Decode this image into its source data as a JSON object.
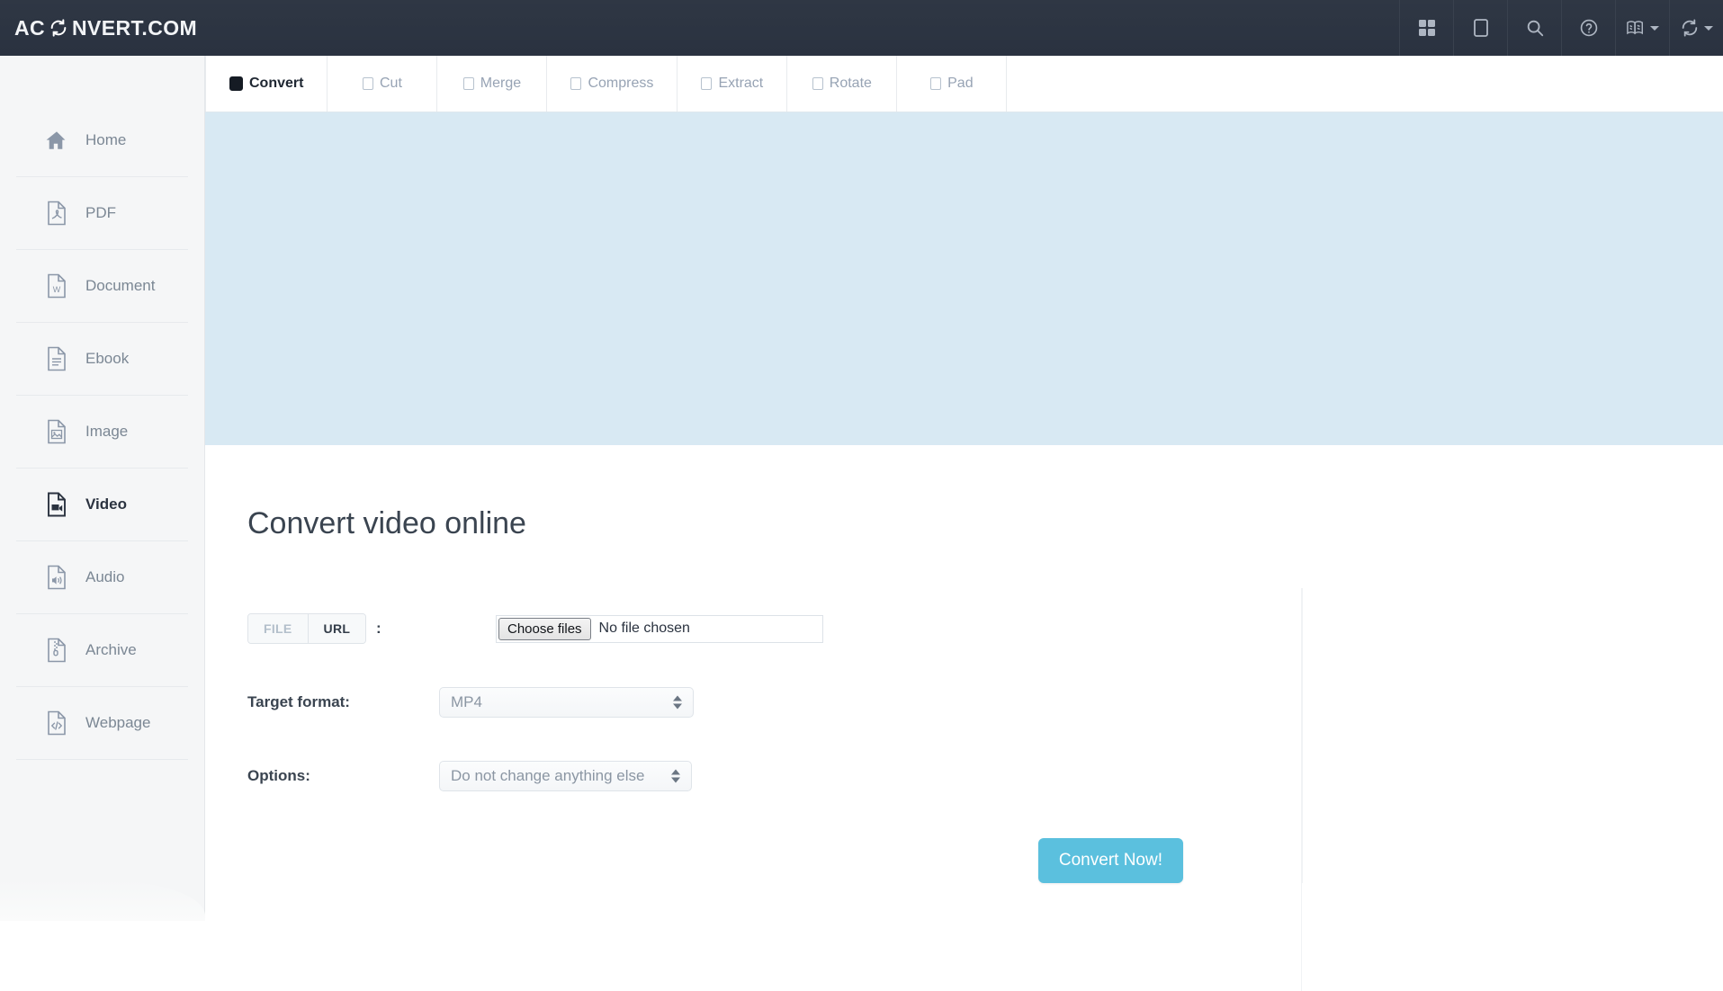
{
  "header": {
    "brand_prefix": "AC",
    "brand_suffix": "NVERT.COM",
    "logo_icon": "circular-arrows-icon",
    "icons": [
      {
        "name": "grid-icon",
        "label": "Apps"
      },
      {
        "name": "tablet-icon",
        "label": "Mobile view"
      },
      {
        "name": "search-icon",
        "label": "Search"
      },
      {
        "name": "help-icon",
        "label": "Help"
      },
      {
        "name": "language-icon",
        "label": "Language",
        "has_caret": true
      },
      {
        "name": "convert-icon",
        "label": "Convert",
        "has_caret": true
      }
    ]
  },
  "sidebar": {
    "items": [
      {
        "label": "Home",
        "icon": "home-icon",
        "active": false
      },
      {
        "label": "PDF",
        "icon": "pdf-file-icon",
        "active": false
      },
      {
        "label": "Document",
        "icon": "word-file-icon",
        "active": false
      },
      {
        "label": "Ebook",
        "icon": "text-file-icon",
        "active": false
      },
      {
        "label": "Image",
        "icon": "image-file-icon",
        "active": false
      },
      {
        "label": "Video",
        "icon": "video-file-icon",
        "active": true
      },
      {
        "label": "Audio",
        "icon": "audio-file-icon",
        "active": false
      },
      {
        "label": "Archive",
        "icon": "archive-file-icon",
        "active": false
      },
      {
        "label": "Webpage",
        "icon": "code-file-icon",
        "active": false
      }
    ]
  },
  "tabs": [
    {
      "label": "Convert",
      "active": true
    },
    {
      "label": "Cut",
      "active": false
    },
    {
      "label": "Merge",
      "active": false
    },
    {
      "label": "Compress",
      "active": false
    },
    {
      "label": "Extract",
      "active": false
    },
    {
      "label": "Rotate",
      "active": false
    },
    {
      "label": "Pad",
      "active": false
    }
  ],
  "main": {
    "page_title": "Convert video online",
    "source": {
      "file_tab": "FILE",
      "url_tab": "URL",
      "colon": ":",
      "choose_button": "Choose files",
      "file_status": "No file chosen"
    },
    "target_format": {
      "label": "Target format:",
      "value": "MP4"
    },
    "options": {
      "label": "Options:",
      "value": "Do not change anything else"
    },
    "submit_label": "Convert Now!"
  },
  "colors": {
    "header_bg": "#2a3240",
    "sidebar_bg": "#f5f6f7",
    "banner_bg": "#d8e9f3",
    "accent": "#5bc0de",
    "text_dark": "#3a4450",
    "text_muted": "#7b8794"
  }
}
